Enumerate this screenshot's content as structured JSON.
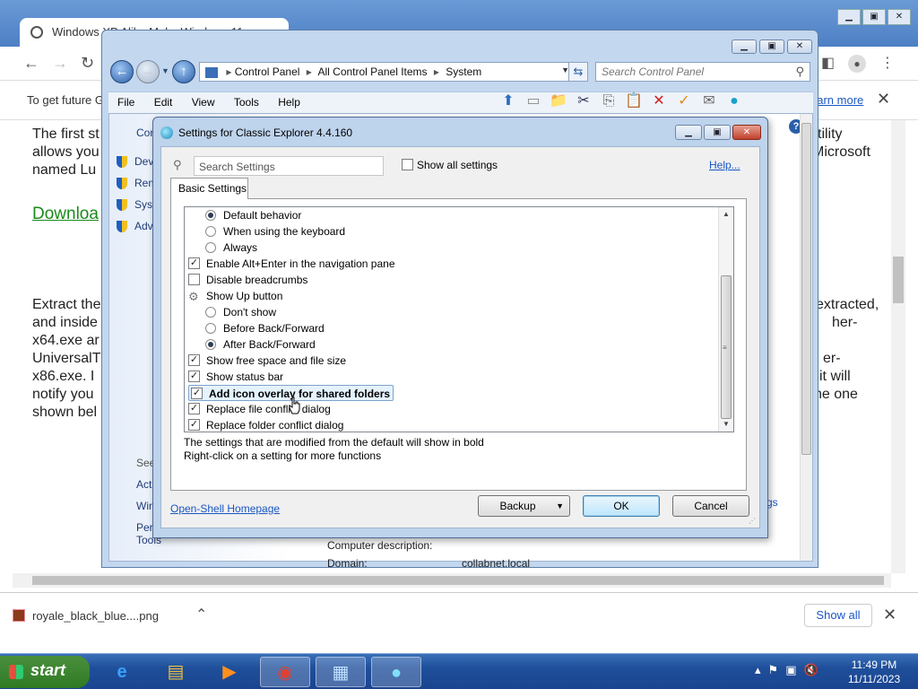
{
  "browser": {
    "tab_title": "Windows XP Alike Make Windows 11...",
    "info_message": "To get future G",
    "info_link": "earn more",
    "page_lines_left": [
      "The first st",
      "allows you",
      "named Lu"
    ],
    "page_lines_right": [
      "tility",
      "Microsoft"
    ],
    "download_link": "Downloa",
    "page_lines_left2": [
      "Extract the",
      "and inside",
      "x64.exe ar",
      "UniversalT",
      "x86.exe.  I",
      "notify you",
      "shown bel"
    ],
    "page_lines_right2": [
      "extracted,",
      "her-",
      "",
      "er-",
      "it will",
      "he one"
    ],
    "downloads": {
      "file": "royale_black_blue....png",
      "show_all": "Show all"
    }
  },
  "control_panel": {
    "address": [
      "Control Panel",
      "All Control Panel Items",
      "System"
    ],
    "search_placeholder": "Search Control Panel",
    "menu": [
      "File",
      "Edit",
      "View",
      "Tools",
      "Help"
    ],
    "left_partial": [
      "Con",
      "Dev",
      "Rem",
      "Sys",
      "Adv"
    ],
    "left_see_also": [
      "See",
      "Act",
      "Win",
      "Perf",
      "Tools"
    ],
    "right_lines": [
      "Computer description:",
      "Domain:",
      "collabnet.local",
      "gs"
    ]
  },
  "dialog": {
    "title": "Settings for Classic Explorer 4.4.160",
    "search_placeholder": "Search Settings",
    "show_all_label": "Show all settings",
    "help_link": "Help...",
    "tab": "Basic Settings",
    "settings": [
      {
        "kind": "radio",
        "indent": 1,
        "checked": true,
        "label": "Default behavior"
      },
      {
        "kind": "radio",
        "indent": 1,
        "checked": false,
        "label": "When using the keyboard"
      },
      {
        "kind": "radio",
        "indent": 1,
        "checked": false,
        "label": "Always"
      },
      {
        "kind": "check",
        "indent": 0,
        "checked": true,
        "label": "Enable Alt+Enter in the navigation pane"
      },
      {
        "kind": "check",
        "indent": 0,
        "checked": false,
        "label": "Disable breadcrumbs"
      },
      {
        "kind": "group",
        "indent": 0,
        "checked": false,
        "label": "Show Up button"
      },
      {
        "kind": "radio",
        "indent": 1,
        "checked": false,
        "label": "Don't show"
      },
      {
        "kind": "radio",
        "indent": 1,
        "checked": false,
        "label": "Before Back/Forward"
      },
      {
        "kind": "radio",
        "indent": 1,
        "checked": true,
        "label": "After Back/Forward"
      },
      {
        "kind": "check",
        "indent": 0,
        "checked": true,
        "label": "Show free space and file size"
      },
      {
        "kind": "check",
        "indent": 0,
        "checked": true,
        "label": "Show status bar"
      },
      {
        "kind": "check",
        "indent": 0,
        "checked": true,
        "label": "Add icon overlay for shared folders",
        "selected": true,
        "bold": true
      },
      {
        "kind": "check",
        "indent": 0,
        "checked": true,
        "label": "Replace file conflict dialog"
      },
      {
        "kind": "check",
        "indent": 0,
        "checked": true,
        "label": "Replace folder conflict dialog"
      }
    ],
    "desc_line1": "The settings that are modified from the default will show in bold",
    "desc_line2": "Right-click on a setting for more functions",
    "homepage_link": "Open-Shell Homepage",
    "backup_button": "Backup",
    "ok_button": "OK",
    "cancel_button": "Cancel"
  },
  "taskbar": {
    "start_label": "start",
    "time": "11:49 PM",
    "date": "11/11/2023"
  }
}
